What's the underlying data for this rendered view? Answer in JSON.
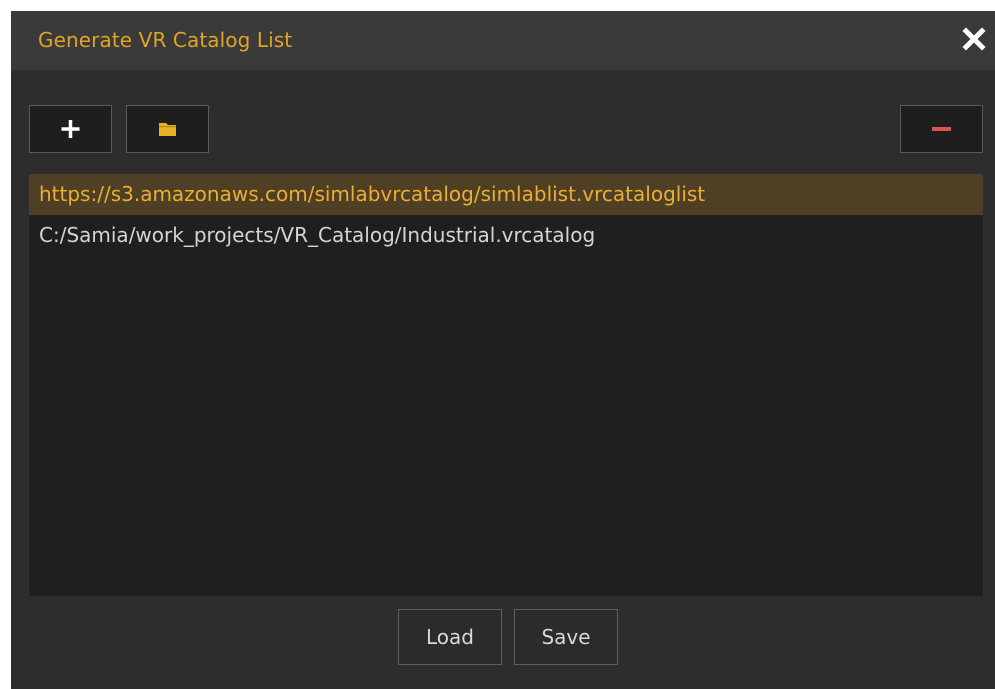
{
  "window": {
    "title": "Generate VR Catalog List",
    "close_icon": "close-icon",
    "title_color": "#e0a424"
  },
  "toolbar": {
    "add_icon": "plus-icon",
    "open_folder_icon": "folder-icon",
    "remove_icon": "minus-icon",
    "remove_color": "#d9534f",
    "folder_color": "#e6b325"
  },
  "catalog_list": {
    "items": [
      {
        "label": "https://s3.amazonaws.com/simlabvrcatalog/simlablist.vrcataloglist",
        "selected": true
      },
      {
        "label": "C:/Samia/work_projects/VR_Catalog/Industrial.vrcatalog",
        "selected": false
      }
    ],
    "selected_color": "#4f3f24"
  },
  "footer": {
    "load_label": "Load",
    "save_label": "Save"
  }
}
